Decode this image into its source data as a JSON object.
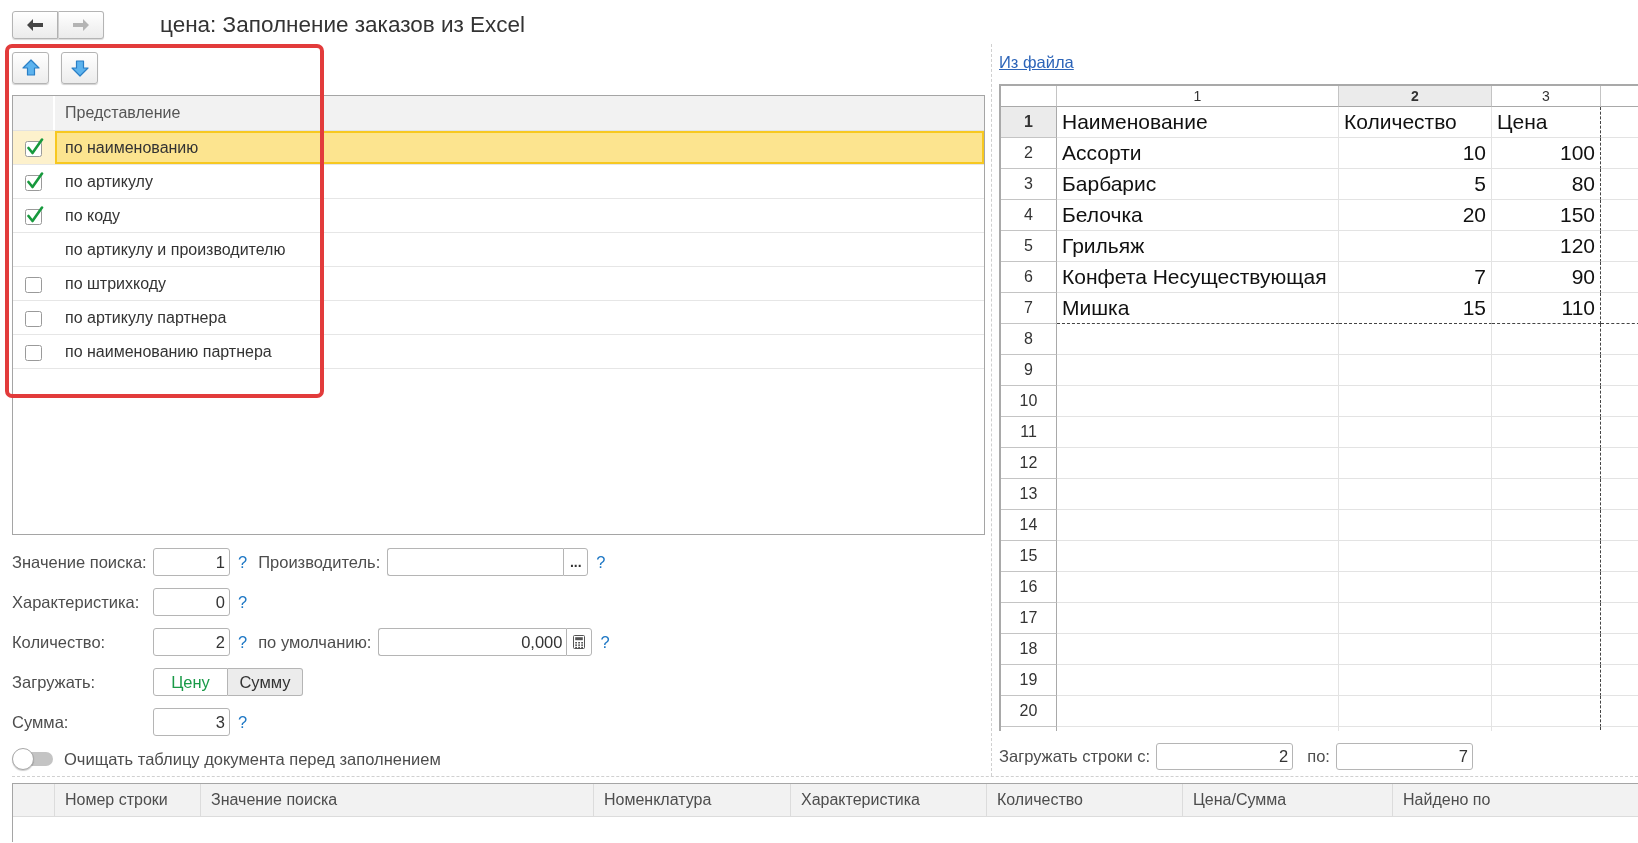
{
  "window": {
    "title": "цена: Заполнение заказов из Excel",
    "nav": [
      {
        "kind": "back",
        "disabled": false
      },
      {
        "kind": "forward",
        "disabled": true
      }
    ]
  },
  "search_methods": {
    "highlighted": true,
    "column": "Представление",
    "rows": [
      {
        "kind": "checkbox",
        "label": "по наименованию",
        "checked": true,
        "selected": true
      },
      {
        "kind": "checkbox",
        "label": "по артикулу",
        "checked": true,
        "selected": false
      },
      {
        "kind": "checkbox",
        "label": "по коду",
        "checked": true,
        "selected": false
      },
      {
        "kind": "plain",
        "label": "по артикулу и производителю",
        "selected": false
      },
      {
        "kind": "checkbox",
        "label": "по штрихкоду",
        "checked": false,
        "selected": false
      },
      {
        "kind": "checkbox",
        "label": "по артикулу партнера",
        "checked": false,
        "selected": false
      },
      {
        "kind": "checkbox",
        "label": "по наименованию партнера",
        "checked": false,
        "selected": false
      }
    ]
  },
  "settings": [
    {
      "kind": "number",
      "label": "Значение поиска:",
      "value": "1",
      "help": "?",
      "side": {
        "kind": "choice",
        "label": "Производитель:",
        "button": "...",
        "help": "?"
      }
    },
    {
      "kind": "number",
      "label": "Характеристика:",
      "value": "0",
      "help": "?"
    },
    {
      "kind": "number",
      "label": "Количество:",
      "value": "2",
      "help": "?",
      "side": {
        "kind": "calculator",
        "label": "по умолчанию:",
        "value": "0,000",
        "help": "?"
      }
    },
    {
      "kind": "segments",
      "label": "Загружать:",
      "options": [
        {
          "label": "Цену",
          "selected": true
        },
        {
          "label": "Сумму",
          "selected": false
        }
      ]
    },
    {
      "kind": "number",
      "label": "Сумма:",
      "value": "3",
      "help": "?"
    }
  ],
  "clear_table": {
    "label": "Очищать таблицу документа перед заполнением",
    "on": false
  },
  "source": {
    "link": "Из файла",
    "sheet": {
      "columns": [
        {
          "label": "1",
          "selected": false
        },
        {
          "label": "2",
          "selected": true
        },
        {
          "label": "3",
          "selected": false
        }
      ],
      "rows": [
        {
          "number": "1",
          "selected": true,
          "kind": "header",
          "cells": [
            "Наименование",
            "Количество",
            "Цена"
          ]
        },
        {
          "number": "2",
          "selected": false,
          "kind": "item",
          "cells": [
            "Ассорти",
            "10",
            "100"
          ]
        },
        {
          "number": "3",
          "selected": false,
          "kind": "item",
          "cells": [
            "Барбарис",
            "5",
            "80"
          ]
        },
        {
          "number": "4",
          "selected": false,
          "kind": "item",
          "cells": [
            "Белочка",
            "20",
            "150"
          ]
        },
        {
          "number": "5",
          "selected": false,
          "kind": "item",
          "cells": [
            "Грильяж",
            null,
            "120"
          ]
        },
        {
          "number": "6",
          "selected": false,
          "kind": "item",
          "cells": [
            "Конфета Несуществующая",
            "7",
            "90"
          ]
        },
        {
          "number": "7",
          "selected": false,
          "kind": "item",
          "cells": [
            "Мишка",
            "15",
            "110"
          ]
        },
        {
          "number": "8",
          "selected": false,
          "kind": "empty"
        },
        {
          "number": "9",
          "selected": false,
          "kind": "empty"
        },
        {
          "number": "10",
          "selected": false,
          "kind": "empty"
        },
        {
          "number": "11",
          "selected": false,
          "kind": "empty"
        },
        {
          "number": "12",
          "selected": false,
          "kind": "empty"
        },
        {
          "number": "13",
          "selected": false,
          "kind": "empty"
        },
        {
          "number": "14",
          "selected": false,
          "kind": "empty"
        },
        {
          "number": "15",
          "selected": false,
          "kind": "empty"
        },
        {
          "number": "16",
          "selected": false,
          "kind": "empty"
        },
        {
          "number": "17",
          "selected": false,
          "kind": "empty"
        },
        {
          "number": "18",
          "selected": false,
          "kind": "empty"
        },
        {
          "number": "19",
          "selected": false,
          "kind": "empty"
        },
        {
          "number": "20",
          "selected": false,
          "kind": "empty"
        }
      ]
    },
    "load_rows": {
      "from_label": "Загружать строки с:",
      "from": "2",
      "to_label": "по:",
      "to": "7"
    }
  },
  "results_table": {
    "columns": [
      "Номер строки",
      "Значение поиска",
      "Номенклатура",
      "Характеристика",
      "Количество",
      "Цена/Сумма",
      "Найдено по"
    ]
  }
}
